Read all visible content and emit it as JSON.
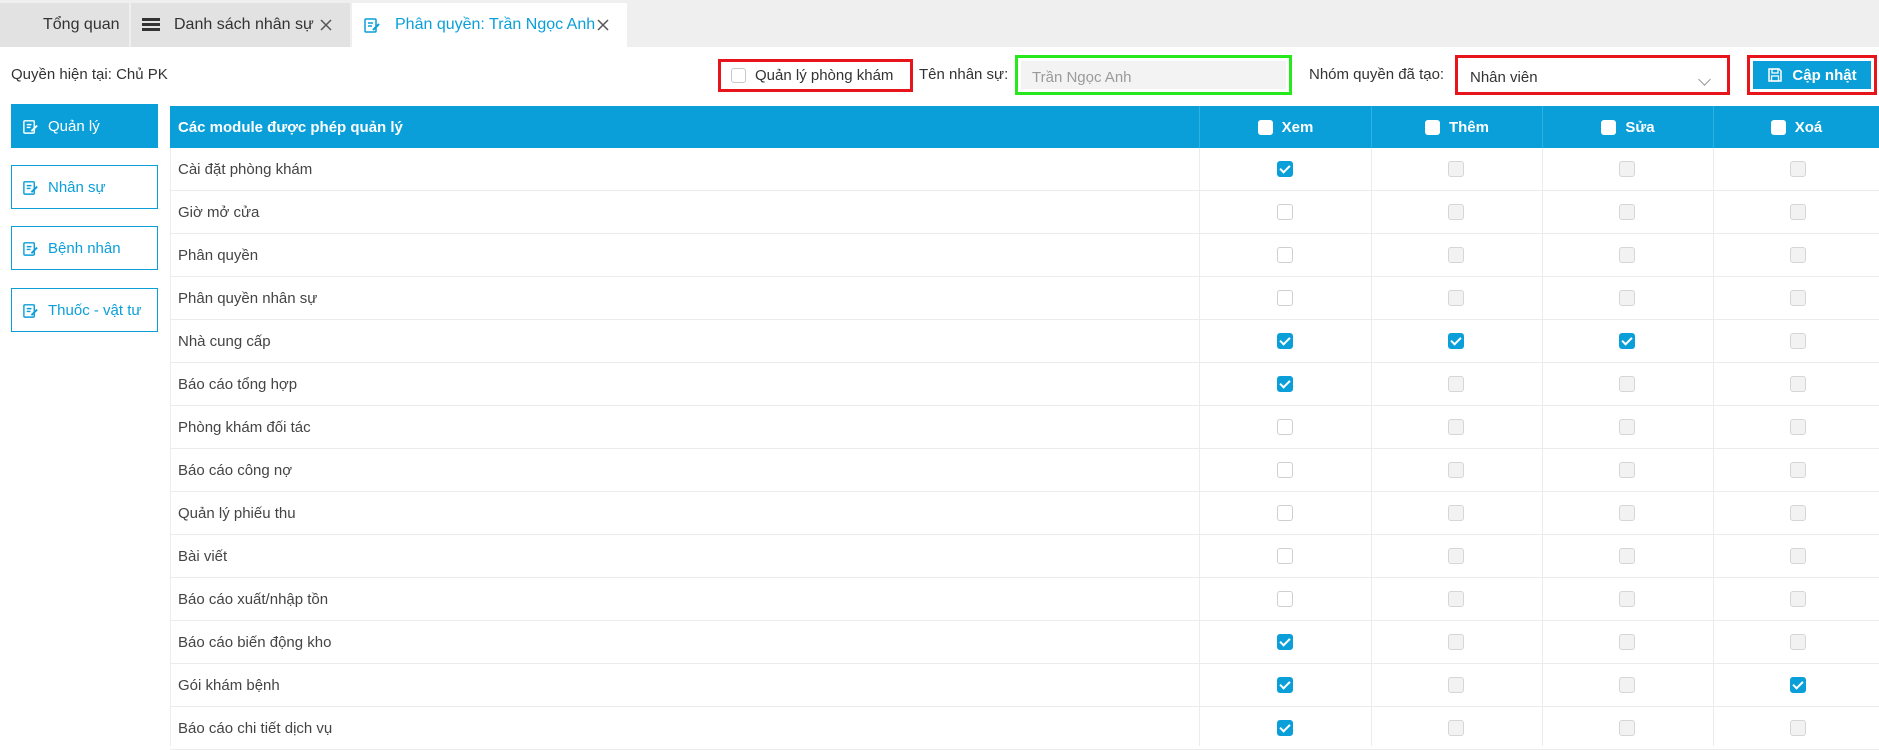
{
  "tabs": [
    {
      "label": "Tổng quan",
      "icon": "dashboard-icon"
    },
    {
      "label": "Danh sách nhân sự",
      "icon": "list-icon"
    },
    {
      "label": "Phân quyền: Trần Ngọc Anh",
      "icon": "permission-icon"
    }
  ],
  "toolbar": {
    "current_role": "Quyền hiện tại: Chủ PK",
    "clinic_manager_label": "Quản lý phòng khám",
    "staff_label": "Tên nhân sự:",
    "staff_value": "Trần Ngọc Anh",
    "group_label": "Nhóm quyền đã tạo:",
    "group_value": "Nhân viên",
    "save_label": "Cập nhật"
  },
  "sidebar": {
    "items": [
      {
        "label": "Quản lý",
        "active": true
      },
      {
        "label": "Nhân sự",
        "active": false
      },
      {
        "label": "Bệnh nhân",
        "active": false
      },
      {
        "label": "Thuốc - vật tư",
        "active": false
      }
    ]
  },
  "table": {
    "module_header": "Các module được phép quản lý",
    "perm_headers": [
      "Xem",
      "Thêm",
      "Sửa",
      "Xoá"
    ],
    "rows": [
      {
        "name": "Cài đặt phòng khám",
        "perms": [
          1,
          0,
          0,
          0
        ]
      },
      {
        "name": "Giờ mở cửa",
        "perms": [
          0,
          0,
          0,
          0
        ]
      },
      {
        "name": "Phân quyền",
        "perms": [
          0,
          0,
          0,
          0
        ]
      },
      {
        "name": "Phân quyền nhân sự",
        "perms": [
          0,
          0,
          0,
          0
        ]
      },
      {
        "name": "Nhà cung cấp",
        "perms": [
          1,
          1,
          1,
          0
        ]
      },
      {
        "name": "Báo cáo tổng hợp",
        "perms": [
          1,
          0,
          0,
          0
        ]
      },
      {
        "name": "Phòng khám đối tác",
        "perms": [
          0,
          0,
          0,
          0
        ]
      },
      {
        "name": "Báo cáo công nợ",
        "perms": [
          0,
          0,
          0,
          0
        ]
      },
      {
        "name": "Quản lý phiếu thu",
        "perms": [
          0,
          0,
          0,
          0
        ]
      },
      {
        "name": "Bài viết",
        "perms": [
          0,
          0,
          0,
          0
        ]
      },
      {
        "name": "Báo cáo xuất/nhập tồn",
        "perms": [
          0,
          0,
          0,
          0
        ]
      },
      {
        "name": "Báo cáo biến động kho",
        "perms": [
          1,
          0,
          0,
          0
        ]
      },
      {
        "name": "Gói khám bệnh",
        "perms": [
          1,
          0,
          0,
          1
        ]
      },
      {
        "name": "Báo cáo chi tiết dịch vụ",
        "perms": [
          1,
          0,
          0,
          0
        ]
      }
    ]
  },
  "colors": {
    "accent": "#0a9fd8",
    "highlight_red": "#e8141b",
    "highlight_green": "#26e81a"
  }
}
